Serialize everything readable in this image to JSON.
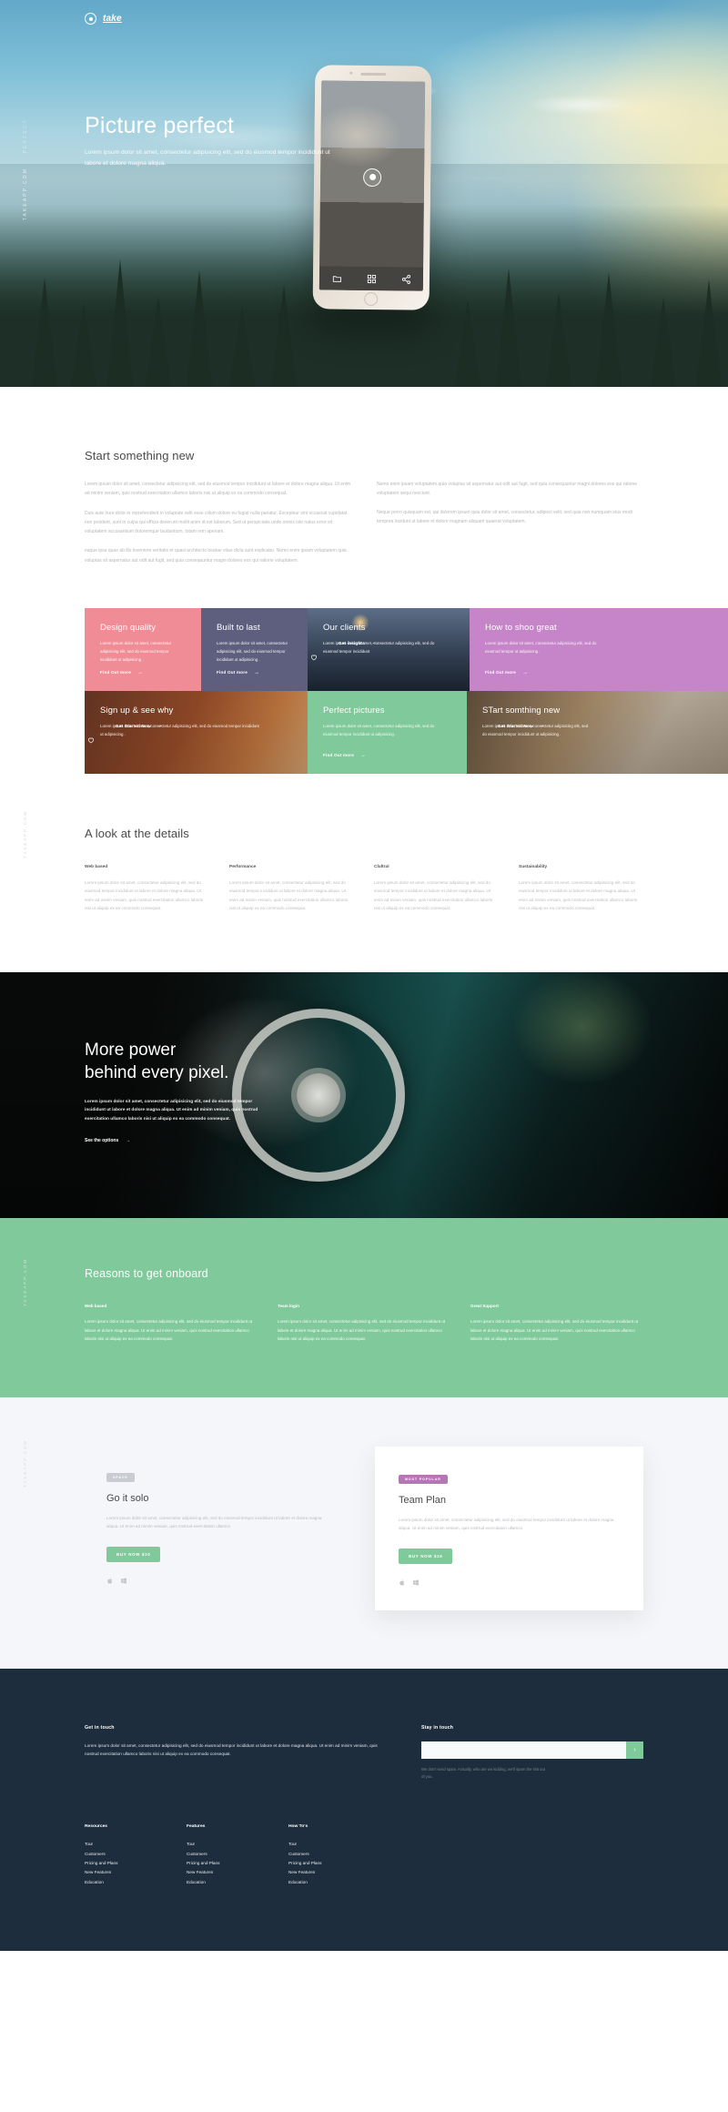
{
  "brand": {
    "name": "take",
    "logo_icon": "circle-dot-icon"
  },
  "hero": {
    "side_label_primary": "TAKEAPP.COM",
    "side_label_secondary": "PERFECT",
    "title": "Picture perfect",
    "subtitle": "Lorem ipsum dolor sit amet, consectetur adipisicing elit, sed do eiusmod tempor incididunt ut labore et dolore magna aliqua.",
    "phone_icons": [
      "folder-icon",
      "grid-icon",
      "share-icon"
    ],
    "shutter_icon": "camera-shutter-icon"
  },
  "start_section": {
    "title": "Start something new",
    "left_paragraphs": [
      "Lorem ipsum dolor sit amet, consectetur adipisicing elit, sed do eiusmod tempor incididunt ut labore et dolore magna aliqua. Ut enim ad minim veniam, quis nostrud exercitation ullamco laboris nisi ut aliquip ex ea commodo consequat.",
      "Duis aute irure dolor in reprehenderit in voluptate velit esse cillum dolore eu fugiat nulla pariatur. Excepteur sint occaecat cupidatat non proident, sunt in culpa qui officia deserunt mollit anim id est laborum. Sed ut perspiciatis unde omnis iste natus error sit voluptatem accusantium doloremque laudantium, totam rem aperiam.",
      "eaque ipsa quae ab illo inventore veritatis et quasi architecto beatae vitae dicta sunt explicabo. Nemo enim ipsam voluptatem quia voluptas sit aspernatur aut odit aut fugit, sed quia consequuntur magni dolores eos qui ratione voluptatem."
    ],
    "right_paragraphs": [
      "Nemo enim ipsam voluptatem quia voluptas sit aspernatur aut odit aut fugit, sed quia consequuntur magni dolores eos qui ratione voluptatem sequi nesciunt.",
      "Neque porro quisquam est, qui dolorem ipsum quia dolor sit amet, consectetur, adipisci velit, sed quia non numquam eius modi tempora incidunt ut labore et dolore magnam aliquam quaerat voluptatem."
    ]
  },
  "tiles": {
    "row1": [
      {
        "title": "Design quality",
        "text": "Lorem ipsum dolor sit amet, consectetur adipisicing elit, sed do eiusmod tempor incididunt ut adipisicing .",
        "cta": "Find Out more",
        "color": "#f08c96",
        "kind": "solid",
        "heart": false
      },
      {
        "title": "Built to last",
        "text": "Lorem ipsum dolor sit amet, consectetur adipisicing elit, sed do eiusmod tempor incididunt ut adipisicing .",
        "cta": "Find Out more",
        "color": "#5e5f7e",
        "kind": "solid",
        "heart": false
      },
      {
        "title": "Our clients",
        "text": "Lorem ipsum dolor sit amet, consectetur adipisicing elit, sed do eiusmod tempor incididunt",
        "cta": "Get insights",
        "color": "#3a4a60",
        "kind": "photo-clients",
        "heart": true
      },
      {
        "title": "How to shoo great",
        "text": "Lorem ipsum dolor sit amet, consectetur adipisicing elit, sed do eiusmod tempor ut adipisicing .",
        "cta": "Find Out more",
        "color": "#c585c8",
        "kind": "solid",
        "heart": false
      }
    ],
    "row2": [
      {
        "title": "Sign up & see why",
        "text": "Lorem ipsum dolor sit amet, consectetur adipisicing elit, sed do eiusmod tempor incididunt ut adipisicing .",
        "cta": "Get Started Now",
        "color": "#b5693c",
        "kind": "photo-signup",
        "heart": true
      },
      {
        "title": "Perfect pictures",
        "text": "Lorem ipsum dolor sit amet, consectetur adipisicing elit, sed do eiusmod tempor incididunt ut adipisicing .",
        "cta": "Find Out more",
        "color": "#7fc99a",
        "kind": "solid",
        "heart": false
      },
      {
        "title": "STart somthing new",
        "text": "Lorem ipsum dolor sit amet, consectetur adipisicing elit, sed do eiusmod tempor incididunt ut adipisicing .",
        "cta": "Get Started Now",
        "color": "#8d8470",
        "kind": "photo-start",
        "heart": false
      }
    ]
  },
  "details_section": {
    "side_label": "TAKEAPP.COM",
    "title": "A look at the details",
    "columns": [
      {
        "heading": "Web based",
        "text": "Lorem ipsum dolor sit amet, consectetur adipisicing elit, sed do eiusmod tempor incididunt ut labore et dolore magna aliqua. Ut enim ad minim veniam, quis nostrud exercitation ullamco laboris nisi ut aliquip ex ea commodo consequat."
      },
      {
        "heading": "Performance",
        "text": "Lorem ipsum dolor sit amet, consectetur adipisicing elit, sed do eiusmod tempor incididunt ut labore et dolore magna aliqua. Ut enim ad minim veniam, quis nostrud exercitation ullamco laboris nisi ut aliquip ex ea commodo consequat."
      },
      {
        "heading": "Clultral",
        "text": "Lorem ipsum dolor sit amet, consectetur adipisicing elit, sed do eiusmod tempor incididunt ut labore et dolore magna aliqua. Ut enim ad minim veniam, quis nostrud exercitation ullamco laboris nisi ut aliquip ex ea commodo consequat."
      },
      {
        "heading": "Sustainability",
        "text": "Lorem ipsum dolor sit amet, consectetur adipisicing elit, sed do eiusmod tempor incididunt ut labore et dolore magna aliqua. Ut enim ad minim veniam, quis nostrud exercitation ullamco laboris nisi ut aliquip ex ea commodo consequat."
      }
    ]
  },
  "power_section": {
    "title_line1": "More power",
    "title_line2": "behind every pixel.",
    "text": "Lorem ipsum dolor sit amet, consectetur adipisicing elit, sed do eiusmod tempor incididunt ut labore et dolore magna aliqua. Ut enim ad minim veniam, quis nostrud exercitation ullamco laboris nisi ut aliquip ex ea commodo consequat.",
    "cta": "See the options"
  },
  "reasons_section": {
    "side_label": "TAKEAPP.COM",
    "title": "Reasons to get onboard",
    "columns": [
      {
        "heading": "Web based",
        "text": "Lorem ipsum dolor sit amet, consectetur adipisicing elit, sed do eiusmod tempor incididunt ut labore et dolore magna aliqua. Ut enim ad minim veniam, quis nostrud exercitation ullamco laboris nisi ut aliquip ex ea commodo consequat."
      },
      {
        "heading": "Team login",
        "text": "Lorem ipsum dolor sit amet, consectetur adipisicing elit, sed do eiusmod tempor incididunt ut labore et dolore magna aliqua. Ut enim ad minim veniam, quis nostrud exercitation ullamco laboris nisi ut aliquip ex ea commodo consequat."
      },
      {
        "heading": "Great Support",
        "text": "Lorem ipsum dolor sit amet, consectetur adipisicing elit, sed do eiusmod tempor incididunt ut labore et dolore magna aliqua. Ut enim ad minim veniam, quis nostrud exercitation ullamco laboris nisi ut aliquip ex ea commodo consequat."
      }
    ]
  },
  "pricing_section": {
    "side_label": "TAKEAPP.COM",
    "plans": [
      {
        "badge": "SPACE",
        "title": "Go it solo",
        "text": "Lorem ipsum dolor sit amet, consectetur adipisicing elit, sed do eiusmod tempor incididunt ut labore et dolore magna aliqua. Ut enim ad minim veniam, quis nostrud exercitation ullamco",
        "button": "BUY NOW $10",
        "stores": [
          "apple-icon",
          "windows-icon"
        ]
      },
      {
        "badge": "MOST POPULAR",
        "title": "Team Plan",
        "text": "Lorem ipsum dolor sit amet, consectetur adipisicing elit, sed do eiusmod tempor incididunt ut labore et dolore magna aliqua. Ut enim ad minim veniam, quis nostrud exercitation ullamco",
        "button": "BUY NOW $19",
        "stores": [
          "apple-icon",
          "windows-icon"
        ]
      }
    ]
  },
  "footer": {
    "get_in_touch_heading": "Get in touch",
    "get_in_touch_text": "Lorem ipsum dolor sit amet, consectetur adipisicing elit, sed do eiusmod tempor incididunt ut labore et dolore magna aliqua. Ut enim ad minim veniam, quis nostrud exercitation ullamco laboris nisi ut aliquip ex ea commodo consequat.",
    "stay_in_touch_heading": "Stay in touch",
    "email_placeholder": "",
    "email_value": "",
    "submit_icon": "chevron-right-icon",
    "news_note": "We don't send spam. Actually, who are we kidding, we'll spam the shit out of you.",
    "link_columns": [
      {
        "heading": "Resources",
        "links": [
          "Tour",
          "Customers",
          "Pricing and Plans",
          "New Features",
          "Education"
        ]
      },
      {
        "heading": "Features",
        "links": [
          "Tour",
          "Customers",
          "Pricing and Plans",
          "New Features",
          "Education"
        ]
      },
      {
        "heading": "How To's",
        "links": [
          "Tour",
          "Customers",
          "Pricing and Plans",
          "New Features",
          "Education"
        ]
      }
    ]
  },
  "colors": {
    "accent_green": "#7fc99a",
    "pink": "#f08c96",
    "purple_slate": "#5e5f7e",
    "orchid": "#c585c8",
    "footer_bg": "#1e2d3d"
  }
}
